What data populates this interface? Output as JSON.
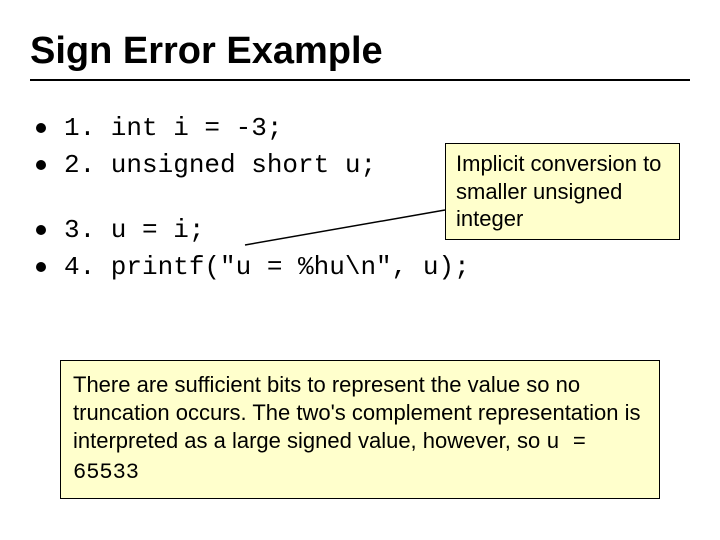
{
  "title": "Sign Error Example",
  "lines": {
    "l1": "1. int i = -3;",
    "l2": "2. unsigned short u;",
    "l3": "3. u = i;",
    "l4": "4. printf(\"u = %hu\\n\", u);"
  },
  "callout1": "Implicit conversion to smaller unsigned integer",
  "note_pre": "There are sufficient bits to represent the value so no truncation occurs.  The two's complement representation is interpreted as a large signed value, however, so ",
  "note_code": "u = 65533"
}
